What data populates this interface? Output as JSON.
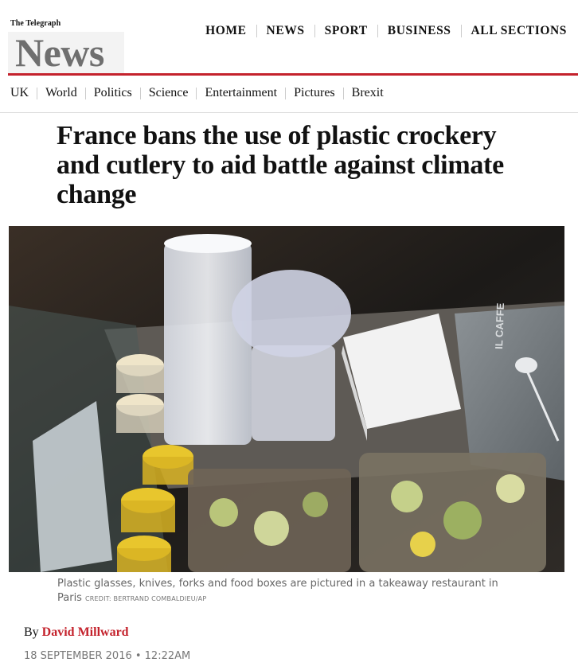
{
  "header": {
    "brand": "The Telegraph",
    "section": "News",
    "nav": [
      "HOME",
      "NEWS",
      "SPORT",
      "BUSINESS",
      "ALL SECTIONS"
    ]
  },
  "subnav": [
    "UK",
    "World",
    "Politics",
    "Science",
    "Entertainment",
    "Pictures",
    "Brexit"
  ],
  "article": {
    "headline": "France bans the use of plastic crockery and cutlery to aid battle against climate change",
    "caption": "Plastic glasses, knives, forks and food boxes are pictured in a takeaway restaurant in Paris",
    "credit": "CREDIT: BERTRAND COMBALDIEU/AP",
    "byline_prefix": "By",
    "author": "David Millward",
    "date": "18 SEPTEMBER 2016 • 12:22AM",
    "photo_tray_text": "IL CAFFE"
  },
  "colors": {
    "accent": "#c4222c",
    "section_title": "#6f6f6f"
  }
}
